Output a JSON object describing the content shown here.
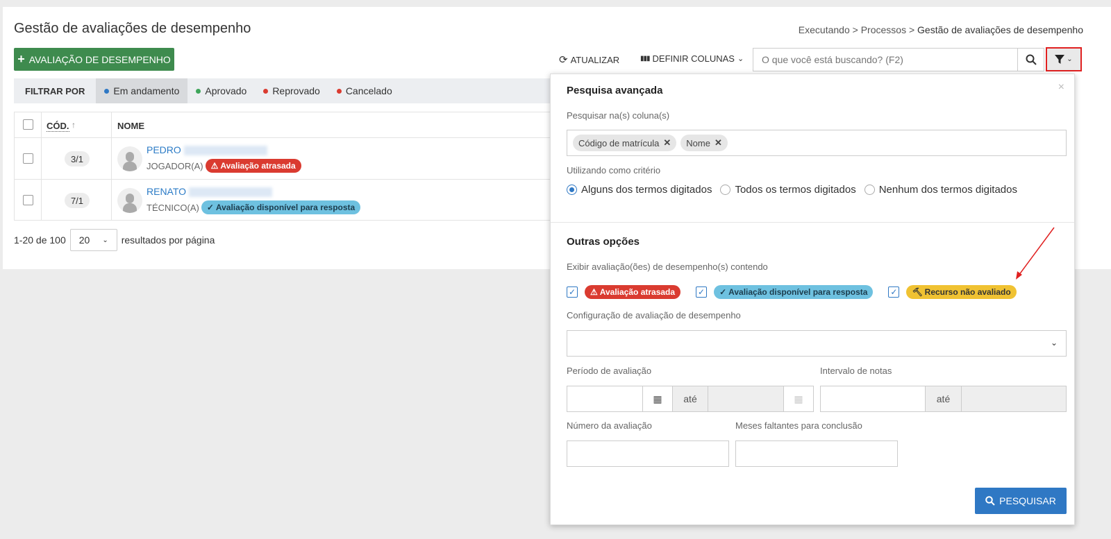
{
  "page": {
    "title": "Gestão de avaliações de desempenho",
    "breadcrumb": [
      "Executando",
      "Processos",
      "Gestão de avaliações de desempenho"
    ]
  },
  "toolbar": {
    "add_label": "AVALIAÇÃO DE DESEMPENHO",
    "refresh_label": "ATUALIZAR",
    "columns_label": "DEFINIR COLUNAS",
    "search_placeholder": "O que você está buscando? (F2)"
  },
  "filter": {
    "label": "FILTRAR POR",
    "items": [
      {
        "label": "Em andamento",
        "color": "#2f78c4",
        "active": true
      },
      {
        "label": "Aprovado",
        "color": "#3ea55a"
      },
      {
        "label": "Reprovado",
        "color": "#da3b30"
      },
      {
        "label": "Cancelado",
        "color": "#da3b30"
      }
    ]
  },
  "table": {
    "headers": {
      "code": "CÓD.",
      "name": "NOME"
    },
    "rows": [
      {
        "code": "3/1",
        "name": "PEDRO",
        "role": "JOGADOR(A)",
        "badge": "Avaliação atrasada"
      },
      {
        "code": "7/1",
        "name": "RENATO",
        "role": "TÉCNICO(A)",
        "badge": "Avaliação disponível para resposta"
      }
    ]
  },
  "pagination": {
    "range": "1-20 de 100",
    "per_page": "20",
    "per_page_label": "resultados por página"
  },
  "advanced": {
    "title": "Pesquisa avançada",
    "columns_label": "Pesquisar na(s) coluna(s)",
    "columns": [
      "Código de matrícula",
      "Nome"
    ],
    "criteria_label": "Utilizando como critério",
    "criteria": [
      {
        "label": "Alguns dos termos digitados",
        "selected": true
      },
      {
        "label": "Todos os termos digitados",
        "selected": false
      },
      {
        "label": "Nenhum dos termos digitados",
        "selected": false
      }
    ],
    "other_title": "Outras opções",
    "show_label": "Exibir avaliação(ões) de desempenho(s) contendo",
    "show_options": [
      {
        "label": "Avaliação atrasada",
        "checked": true
      },
      {
        "label": "Avaliação disponível para resposta",
        "checked": true
      },
      {
        "label": "Recurso não avaliado",
        "checked": true
      }
    ],
    "config_label": "Configuração de avaliação de desempenho",
    "config_value": "",
    "period_label": "Período de avaliação",
    "until": "até",
    "grades_label": "Intervalo de notas",
    "number_label": "Número da avaliação",
    "months_label": "Meses faltantes para conclusão",
    "search_button": "PESQUISAR"
  }
}
